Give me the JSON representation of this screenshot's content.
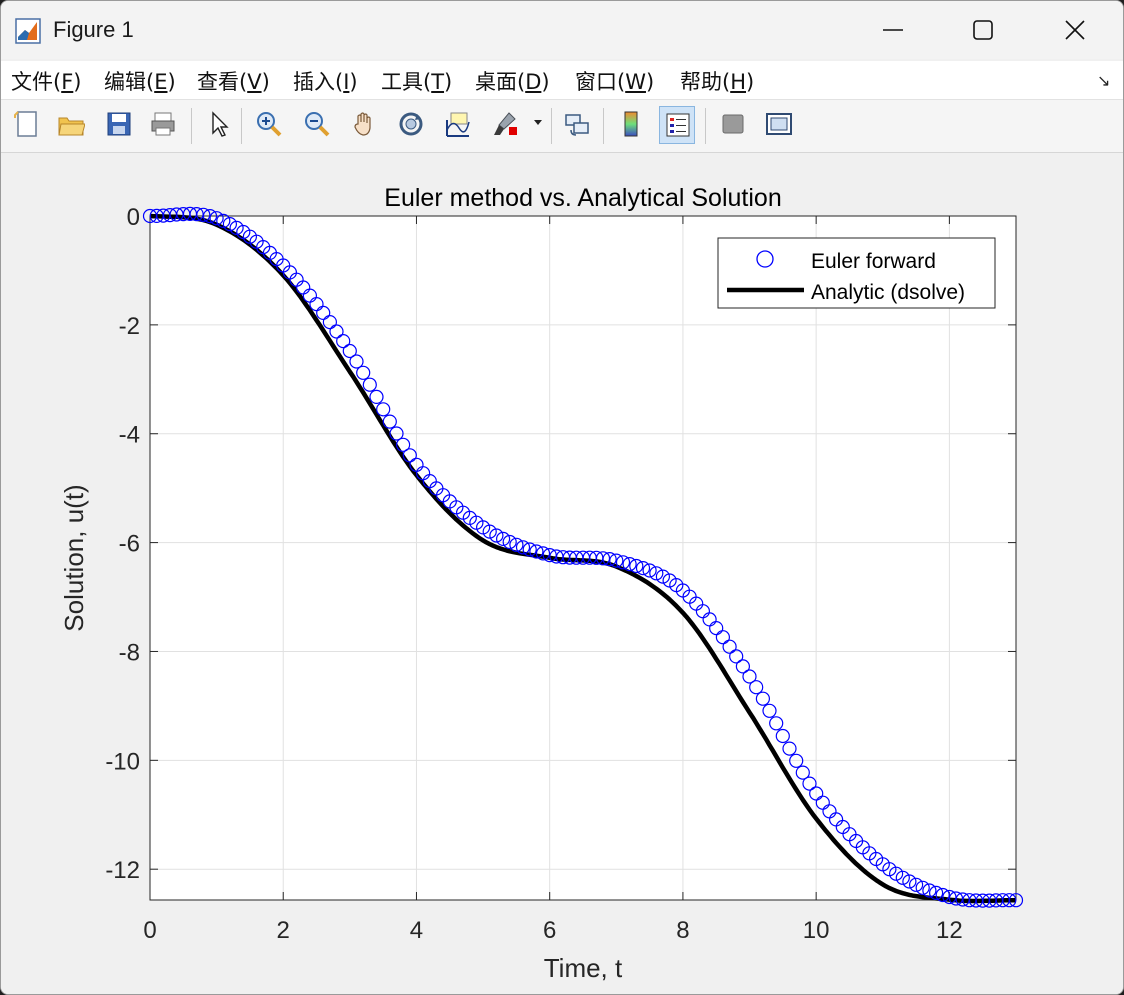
{
  "window": {
    "title": "Figure 1"
  },
  "menu": [
    {
      "label": "文件(",
      "key": "F",
      "end": ")"
    },
    {
      "label": "编辑(",
      "key": "E",
      "end": ")"
    },
    {
      "label": "查看(",
      "key": "V",
      "end": ")"
    },
    {
      "label": "插入(",
      "key": "I",
      "end": ")"
    },
    {
      "label": "工具(",
      "key": "T",
      "end": ")"
    },
    {
      "label": "桌面(",
      "key": "D",
      "end": ")"
    },
    {
      "label": "窗口(",
      "key": "W",
      "end": ")"
    },
    {
      "label": "帮助(",
      "key": "H",
      "end": ")"
    }
  ],
  "toolbar": {
    "buttons": [
      "new-figure-icon",
      "open-file-icon",
      "save-icon",
      "print-icon",
      "edit-plot-arrow-icon",
      "zoom-in-icon",
      "zoom-out-icon",
      "pan-hand-icon",
      "rotate-3d-icon",
      "data-cursor-icon",
      "brush-icon",
      "link-plot-icon",
      "colorbar-icon",
      "legend-icon",
      "hide-plot-tools-icon",
      "show-plot-tools-icon"
    ],
    "active": "legend-icon"
  },
  "chart_data": {
    "type": "line",
    "title": "Euler method vs. Analytical Solution",
    "xlabel": "Time, t",
    "ylabel": "Solution, u(t)",
    "xlim": [
      0,
      13
    ],
    "ylim": [
      -12.566,
      0
    ],
    "xticks": [
      0,
      2,
      4,
      6,
      8,
      10,
      12
    ],
    "yticks": [
      0,
      -2,
      -4,
      -6,
      -8,
      -10,
      -12
    ],
    "grid": true,
    "legend_position": "top-right",
    "series": [
      {
        "name": "Euler forward",
        "style": "markers",
        "marker": "circle",
        "color": "#0000ff",
        "note_step": 0.1,
        "x_start": 0,
        "x_end": 13,
        "x_sample": [
          0,
          1,
          2,
          3,
          4,
          5,
          6,
          7,
          8,
          9,
          10,
          11,
          12,
          13
        ],
        "y_sample": [
          0,
          -0.04,
          -0.91,
          -2.48,
          -4.57,
          -5.72,
          -6.23,
          -6.33,
          -6.88,
          -8.46,
          -10.61,
          -11.91,
          -12.51,
          -12.57
        ]
      },
      {
        "name": "Analytic (dsolve)",
        "style": "line",
        "color": "#000000",
        "x_start": 0,
        "x_end": 13,
        "x_sample": [
          0,
          1,
          2,
          3,
          4,
          5,
          6,
          7,
          8,
          9,
          10,
          11,
          12,
          13
        ],
        "y_sample": [
          0,
          -0.16,
          -1.09,
          -2.86,
          -4.76,
          -5.96,
          -6.28,
          -6.44,
          -7.29,
          -9.12,
          -11.07,
          -12.28,
          -12.56,
          -12.57
        ]
      }
    ]
  }
}
